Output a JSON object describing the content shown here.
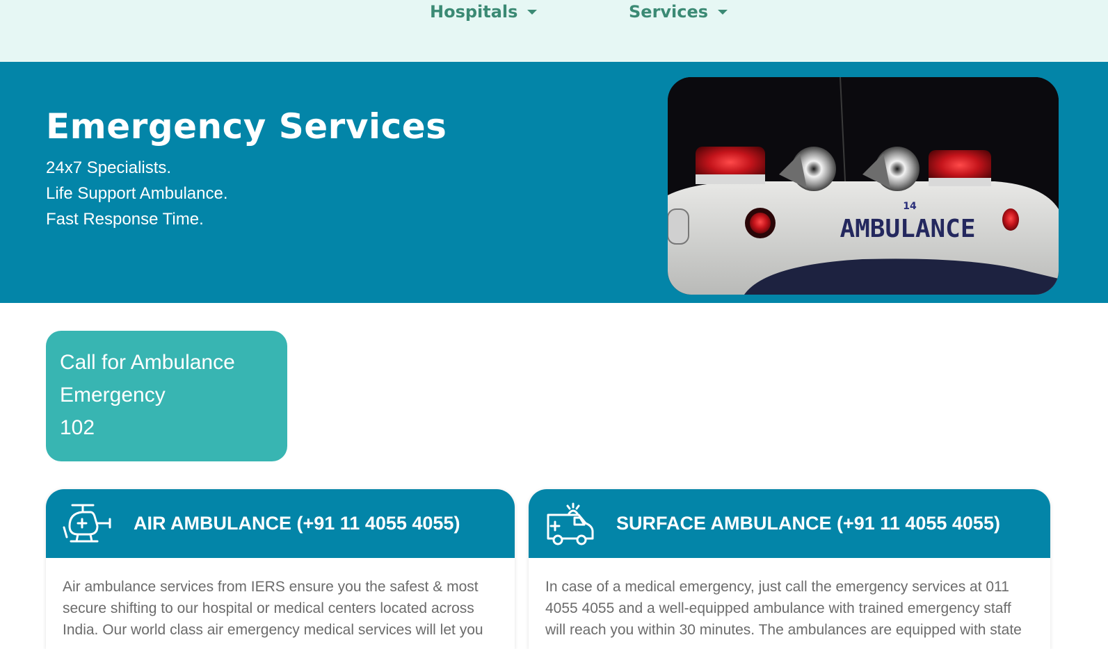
{
  "nav": {
    "items": [
      {
        "label": "Hospitals"
      },
      {
        "label": "Services"
      }
    ]
  },
  "hero": {
    "title": "Emergency Services",
    "lines": [
      "24x7 Specialists.",
      "Life Support Ambulance.",
      "Fast Response Time."
    ],
    "image": {
      "vehicle_text": "AMBULANCE",
      "unit_number": "14"
    }
  },
  "call_box": {
    "line1": "Call for Ambulance",
    "line2": "Emergency",
    "number": "102"
  },
  "cards": [
    {
      "title": "AIR AMBULANCE (+91 11 4055 4055)",
      "icon": "helicopter-icon",
      "body": "Air ambulance services from IERS ensure you the safest & most secure shifting to our hospital or medical centers located across India. Our world class air emergency medical services will let you"
    },
    {
      "title": "SURFACE AMBULANCE (+91 11 4055 4055)",
      "icon": "ambulance-icon",
      "body": "In case of a medical emergency, just call the emergency services at 011 4055 4055 and a well-equipped ambulance with trained emergency staff will reach you within 30 minutes. The ambulances are equipped with state"
    }
  ],
  "colors": {
    "nav_bg": "#e6f7f4",
    "nav_text": "#3b8a74",
    "primary": "#0385a8",
    "accent": "#38b5b2"
  }
}
